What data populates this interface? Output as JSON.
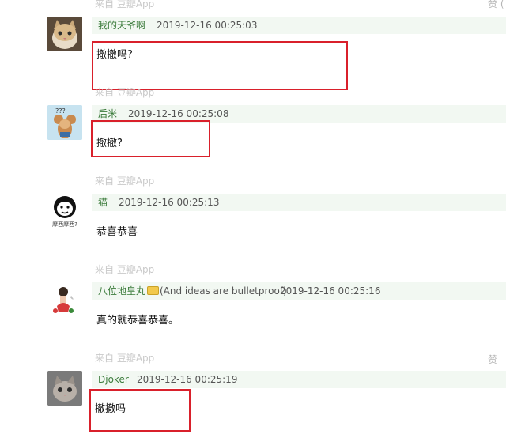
{
  "source_label": "来自 豆瓣App",
  "like_label": "赞",
  "top_like_partial": "赞 (",
  "comments": [
    {
      "user": "我的天爷啊",
      "time": "2019-12-16 00:25:03",
      "text": "撤撤吗?"
    },
    {
      "user": "后米",
      "time": "2019-12-16 00:25:08",
      "text": "撤撤?"
    },
    {
      "user": "猫",
      "time": "2019-12-16 00:25:13",
      "text": "恭喜恭喜",
      "avatar_caption": "摩西摩西?"
    },
    {
      "user": "八位地皇丸",
      "signature": "(And ideas are bulletproof)",
      "time": "2019-12-16 00:25:16",
      "text": "真的就恭喜恭喜。"
    },
    {
      "user": "Djoker",
      "time": "2019-12-16 00:25:19",
      "text": "撤撤吗"
    }
  ],
  "colors": {
    "highlight": "#d9202b",
    "meta_bg": "#f2f8f2",
    "user_link": "#3b7b3b"
  }
}
